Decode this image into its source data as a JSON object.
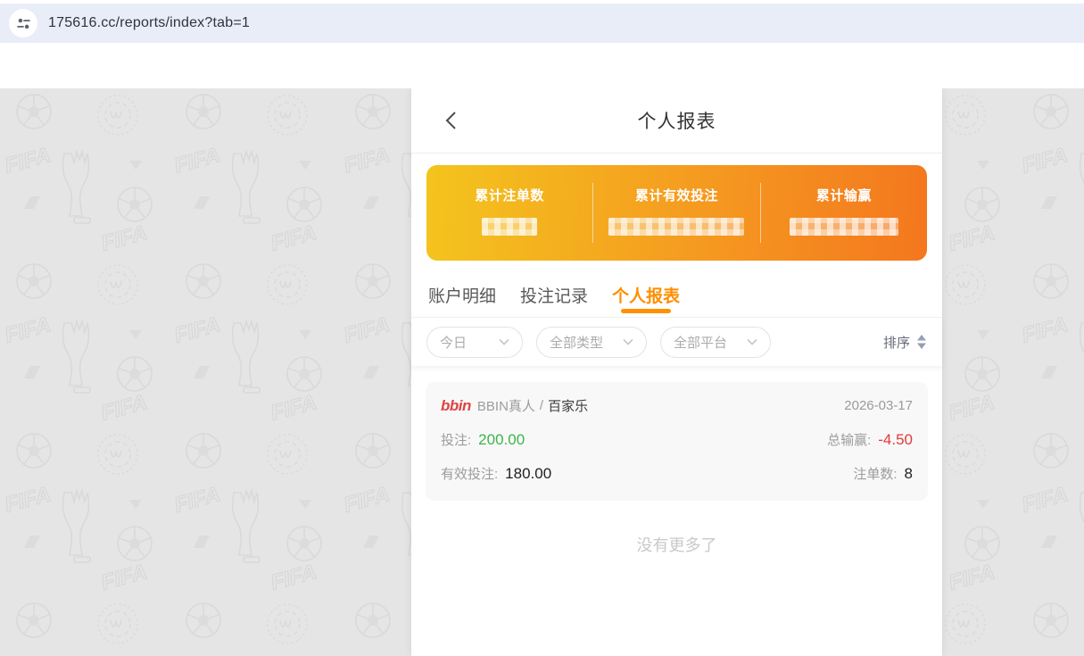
{
  "browser": {
    "url": "175616.cc/reports/index?tab=1",
    "icon": "site-settings-sliders-icon"
  },
  "header": {
    "title": "个人报表"
  },
  "summary": {
    "gradient": [
      "#F4C41D",
      "#F4771E"
    ],
    "items": [
      {
        "label": "累计注单数",
        "value_redacted": true
      },
      {
        "label": "累计有效投注",
        "value_redacted": true
      },
      {
        "label": "累计输赢",
        "value_redacted": true
      }
    ]
  },
  "tabs": {
    "active_color": "#FF8E00",
    "items": [
      {
        "label": "账户明细",
        "active": false
      },
      {
        "label": "投注记录",
        "active": false
      },
      {
        "label": "个人报表",
        "active": true
      }
    ]
  },
  "filters": {
    "dropdowns": [
      {
        "label": "今日"
      },
      {
        "label": "全部类型"
      },
      {
        "label": "全部平台"
      }
    ],
    "sort_label": "排序"
  },
  "records": [
    {
      "logo_text": "bbin",
      "provider": "BBIN真人",
      "separator": "/",
      "game": "百家乐",
      "date": "2026-03-17",
      "rows": [
        {
          "left_label": "投注:",
          "left_value": "200.00",
          "left_color": "#3CB54A",
          "right_label": "总输赢:",
          "right_value": "-4.50",
          "right_color": "#E53935"
        },
        {
          "left_label": "有效投注:",
          "left_value": "180.00",
          "left_color": "#222222",
          "right_label": "注单数:",
          "right_value": "8",
          "right_color": "#222222"
        }
      ]
    }
  ],
  "footer": {
    "no_more": "没有更多了"
  },
  "colors": {
    "tab_active": "#FF8E00",
    "bet_green": "#3CB54A",
    "loss_red": "#E53935",
    "logo_red": "#DC4643",
    "omnibox_bg": "#E9EDF7",
    "stage_bg": "#E5E5E6",
    "card_bg": "#F8F8F9"
  }
}
